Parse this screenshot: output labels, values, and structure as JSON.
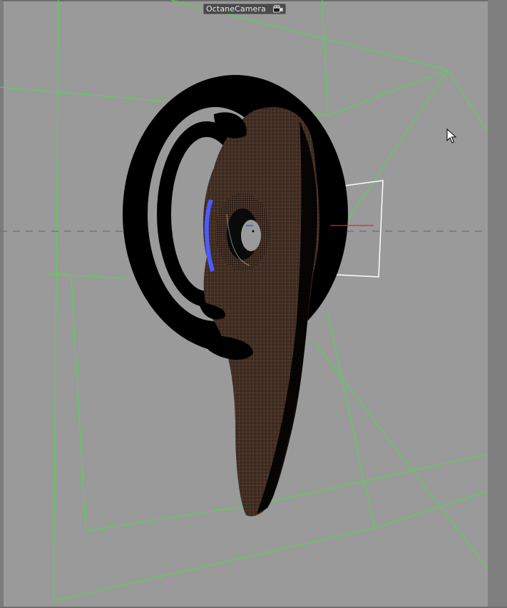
{
  "viewport": {
    "camera_tag": {
      "label": "OctaneCamera",
      "icon": "camera-icon"
    }
  },
  "scene": {
    "object": "ear-mesh",
    "colors": {
      "background": "#9a9a9a",
      "guide_lines": "#4dd94d",
      "mesh": "#3a2a22",
      "mesh_wire": "#6b4a3a",
      "rim": "#000000",
      "highlight": "#4a5cff",
      "axis_x": "#c0392b"
    }
  },
  "cursor": {
    "icon": "pointer-cursor-icon"
  }
}
